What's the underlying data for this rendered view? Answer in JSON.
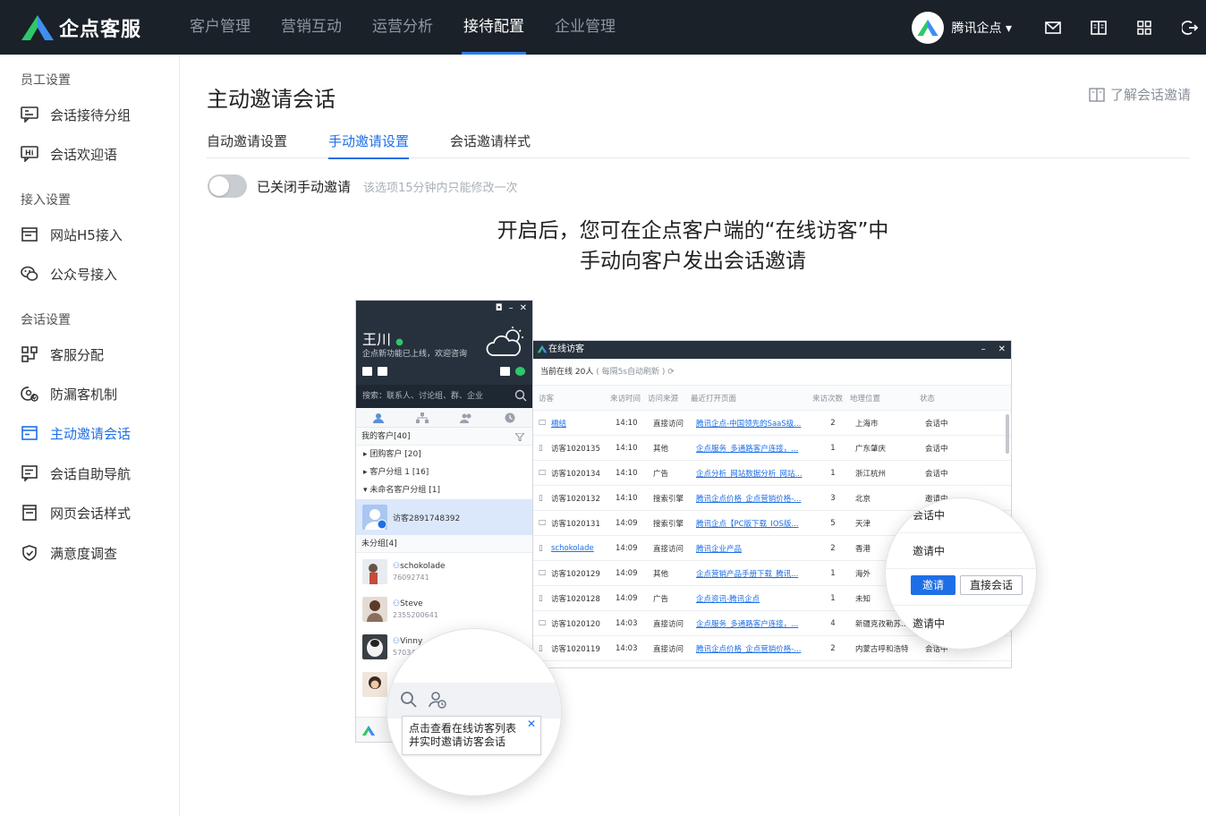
{
  "brand": {
    "name": "企点客服"
  },
  "nav": [
    "客户管理",
    "营销互动",
    "运营分析",
    "接待配置",
    "企业管理"
  ],
  "user": {
    "name": "腾讯企点"
  },
  "sidebar": {
    "groups": [
      {
        "title": "员工设置",
        "items": [
          "会话接待分组",
          "会话欢迎语"
        ]
      },
      {
        "title": "接入设置",
        "items": [
          "网站H5接入",
          "公众号接入"
        ]
      },
      {
        "title": "会话设置",
        "items": [
          "客服分配",
          "防漏客机制",
          "主动邀请会话",
          "会话自助导航",
          "网页会话样式",
          "满意度调查"
        ]
      }
    ]
  },
  "main": {
    "title": "主动邀请会话",
    "help": "了解会话邀请",
    "tabs": [
      "自动邀请设置",
      "手动邀请设置",
      "会话邀请样式"
    ],
    "toggle_label": "已关闭手动邀请",
    "toggle_hint": "该选项15分钟内只能修改一次",
    "headline1": "开启后，您可在企点客户端的“在线访客”中",
    "headline2": "手动向客户发出会话邀请"
  },
  "client": {
    "name": "王川",
    "signature": "企点新功能已上线，欢迎咨询",
    "search": "搜索：联系人、讨论组、群、企业",
    "section": "我的客户[40]",
    "groups": [
      "团购客户 [20]",
      "客户分组 1 [16]",
      "未命名客户分组 [1]"
    ],
    "selected": "访客2891748392",
    "ungroup": "未分组[4]",
    "contacts": [
      {
        "name": "schokolade",
        "id": "76092741"
      },
      {
        "name": "Steve",
        "id": "2355200641"
      },
      {
        "name": "Vinny",
        "id": "57034"
      }
    ],
    "tip_line1": "点击查看在线访客列表",
    "tip_line2": "并实时邀请访客会话"
  },
  "visitor": {
    "title": "在线访客",
    "online": "当前在线 20人",
    "refresh": "( 每隔5s自动刷新 )",
    "headers": [
      "访客",
      "来访时间",
      "访问来源",
      "最近打开页面",
      "来访次数",
      "地理位置",
      "状态"
    ],
    "rows": [
      [
        "楊结",
        "14:10",
        "直接访问",
        "腾讯企点-中国领先的SaaS级...",
        "2",
        "上海市",
        "会话中"
      ],
      [
        "访客1020135",
        "14:10",
        "其他",
        "企点服务_多通路客户连接，...",
        "1",
        "广东肇庆",
        "会话中"
      ],
      [
        "访客1020134",
        "14:10",
        "广告",
        "企点分析_网站数据分析_网站...",
        "1",
        "浙江杭州",
        "会话中"
      ],
      [
        "访客1020132",
        "14:10",
        "搜索引擎",
        "腾讯企点价格_企点营销价格-...",
        "3",
        "北京",
        "邀请中"
      ],
      [
        "访客1020131",
        "14:09",
        "搜索引擎",
        "腾讯企点【PC版下载_IOS版...",
        "5",
        "天津",
        "邀请中"
      ],
      [
        "schokolade",
        "14:09",
        "直接访问",
        "腾讯企业产品",
        "2",
        "香港",
        "邀请中"
      ],
      [
        "访客1020129",
        "14:09",
        "其他",
        "企点营销产品手册下载_腾讯...",
        "1",
        "海外",
        "邀请中"
      ],
      [
        "访客1020128",
        "14:09",
        "广告",
        "企点资讯-腾讯企点",
        "1",
        "未知",
        "邀请中"
      ],
      [
        "访客1020120",
        "14:03",
        "直接访问",
        "企点服务_多通路客户连接，...",
        "4",
        "新疆克孜勒苏...",
        "邀请中"
      ],
      [
        "访客1020119",
        "14:03",
        "直接访问",
        "腾讯企点价格_企点营销价格-...",
        "2",
        "内蒙古呼和浩特",
        "会话中"
      ]
    ]
  },
  "magnifier": {
    "status1": "会话中",
    "status2": "邀请中",
    "status3": "邀请中",
    "invite": "邀请",
    "direct": "直接会话"
  },
  "colors": {
    "topbar": "#1a2129",
    "accent": "#1e6fe6"
  }
}
